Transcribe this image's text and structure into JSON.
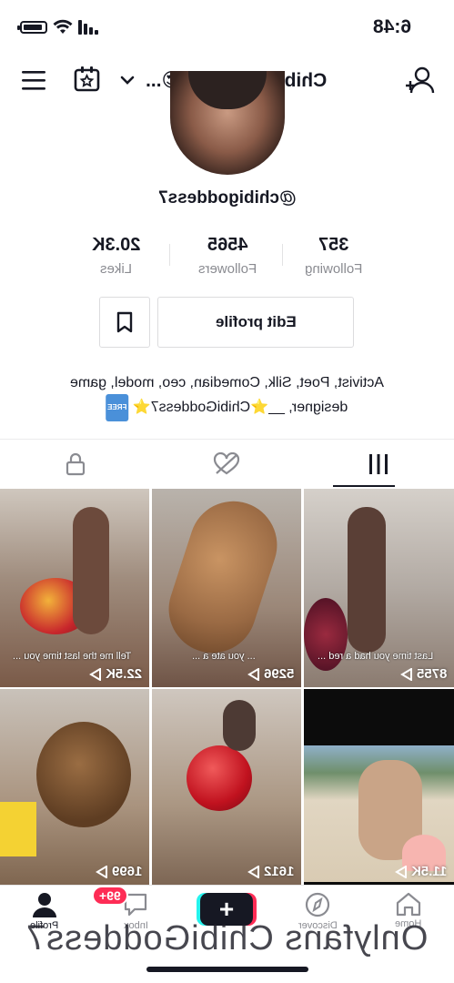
{
  "status_bar": {
    "time": "6:48"
  },
  "header": {
    "title": "ChibiGoddess7 😍..."
  },
  "profile": {
    "handle": "@chibigoddess7",
    "stats": [
      {
        "value": "357",
        "label": "Following"
      },
      {
        "value": "4565",
        "label": "Followers"
      },
      {
        "value": "20.3K",
        "label": "Likes"
      }
    ],
    "edit_label": "Edit profile",
    "bio_line1": "Activist, Poet, Silk, Comedian, ceo, model, game",
    "bio_line2": "designer, __⭐ChibiGoddess7⭐",
    "free_badge": "FREE"
  },
  "videos": [
    {
      "views": "22.5K",
      "caption": "Tell me the last time you ...",
      "bg": "#8d6e5a"
    },
    {
      "views": "5296",
      "caption": "... you ate a ...",
      "bg": "#a47c5b"
    },
    {
      "views": "8755",
      "caption": "Last time you had a red ...",
      "bg": "#8a7c78"
    },
    {
      "views": "1699",
      "caption": "",
      "bg": "#9b8069"
    },
    {
      "views": "1612",
      "caption": "",
      "bg": "#a58a74"
    },
    {
      "views": "11.5K",
      "caption": "",
      "bg": "#101010"
    }
  ],
  "nav": {
    "home": "Home",
    "discover": "Discover",
    "inbox": "Inbox",
    "profile": "Profile",
    "inbox_badge": "99+"
  },
  "watermark": "Onlyfans ChibiGoddess7",
  "colors": {
    "accent_red": "#fe2c55",
    "accent_cyan": "#25f4ee",
    "text": "#161823"
  }
}
